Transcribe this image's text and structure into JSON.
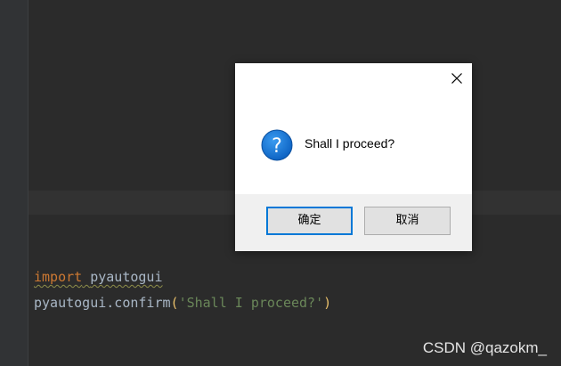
{
  "editor": {
    "line1": {
      "keyword": "import",
      "space": " ",
      "module": "pyautogui"
    },
    "line2": {
      "call": "pyautogui.confirm",
      "open_paren": "(",
      "argument": "'Shall I proceed?'",
      "close_paren": ")"
    },
    "colors": {
      "background": "#2b2b2b",
      "keyword": "#cc7832",
      "identifier": "#a9b7c6",
      "string": "#6a8759",
      "paren": "#e8bf6a"
    }
  },
  "dialog": {
    "message": "Shall I proceed?",
    "icon": "question-icon",
    "close_icon": "close-icon",
    "ok_label": "确定",
    "cancel_label": "取消",
    "accent": "#0078d7"
  },
  "watermark": "CSDN @qazokm_"
}
